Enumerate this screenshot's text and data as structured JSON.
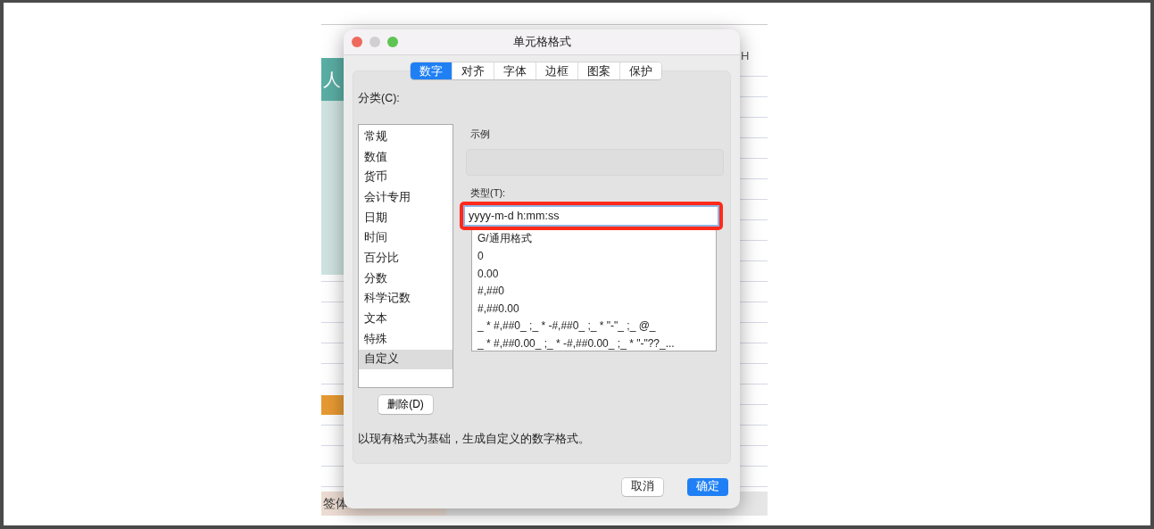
{
  "spreadsheet": {
    "column_header": "H",
    "cell_text": "人",
    "footer_text": "签体"
  },
  "dialog": {
    "title": "单元格格式",
    "tabs": [
      {
        "label": "数字",
        "selected": true
      },
      {
        "label": "对齐",
        "selected": false
      },
      {
        "label": "字体",
        "selected": false
      },
      {
        "label": "边框",
        "selected": false
      },
      {
        "label": "图案",
        "selected": false
      },
      {
        "label": "保护",
        "selected": false
      }
    ],
    "category_label": "分类(C):",
    "categories": [
      {
        "label": "常规",
        "selected": false
      },
      {
        "label": "数值",
        "selected": false
      },
      {
        "label": "货币",
        "selected": false
      },
      {
        "label": "会计专用",
        "selected": false
      },
      {
        "label": "日期",
        "selected": false
      },
      {
        "label": "时间",
        "selected": false
      },
      {
        "label": "百分比",
        "selected": false
      },
      {
        "label": "分数",
        "selected": false
      },
      {
        "label": "科学记数",
        "selected": false
      },
      {
        "label": "文本",
        "selected": false
      },
      {
        "label": "特殊",
        "selected": false
      },
      {
        "label": "自定义",
        "selected": true
      }
    ],
    "delete_button": "删除(D)",
    "sample_label": "示例",
    "type_label": "类型(T):",
    "type_value": "yyyy-m-d h:mm:ss",
    "type_highlighted": true,
    "formats": [
      "G/通用格式",
      "0",
      "0.00",
      "#,##0",
      "#,##0.00",
      "_ * #,##0_ ;_ * -#,##0_ ;_ * \"-\"_ ;_ @_",
      "_ * #,##0.00_ ;_ * -#,##0.00_ ;_ * \"-\"??_..."
    ],
    "description": "以现有格式为基础，生成自定义的数字格式。",
    "buttons": [
      {
        "label": "取消",
        "kind": "secondary"
      },
      {
        "label": "确定",
        "kind": "primary"
      }
    ]
  }
}
